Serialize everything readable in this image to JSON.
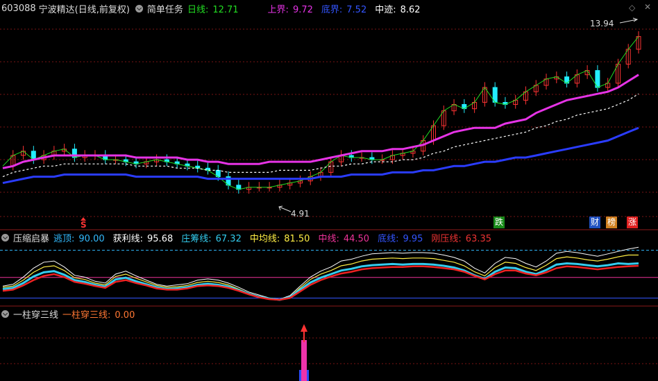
{
  "header": {
    "code": "603088",
    "name": "宁波精达(日线,前复权)",
    "indicator": "简单任务",
    "items": [
      {
        "label": "日线:",
        "value": "12.71",
        "color": "#22dd22"
      },
      {
        "label": "上界:",
        "value": "9.72",
        "color": "#e633e6"
      },
      {
        "label": "底界:",
        "value": "7.52",
        "color": "#3355ff"
      },
      {
        "label": "中迹:",
        "value": "8.62",
        "color": "#ffffff"
      }
    ]
  },
  "corner_icons": [
    "diamond-icon",
    "close-icon"
  ],
  "price_panel": {
    "high_label": "13.94",
    "low_label": "4.91",
    "signal_s": "S",
    "badges": [
      {
        "text": "涨",
        "bg": "#e02020"
      },
      {
        "text": "榜",
        "bg": "#d08020"
      },
      {
        "text": "财",
        "bg": "#2050c0"
      },
      {
        "text": "跌",
        "bg": "#1a8a1a"
      }
    ]
  },
  "indicator_panel": {
    "title": "压缩启暴",
    "items": [
      {
        "label": "逃顶:",
        "value": "90.00",
        "color": "#33bbff"
      },
      {
        "label": "获利线:",
        "value": "95.68",
        "color": "#ffffff"
      },
      {
        "label": "庄筹线:",
        "value": "67.32",
        "color": "#33ccee"
      },
      {
        "label": "中均线:",
        "value": "81.50",
        "color": "#ffee44"
      },
      {
        "label": "中线:",
        "value": "44.50",
        "color": "#ee3399"
      },
      {
        "label": "底线:",
        "value": "9.95",
        "color": "#3355ff"
      },
      {
        "label": "刚压线:",
        "value": "63.35",
        "color": "#ee3333"
      }
    ]
  },
  "column_panel": {
    "title": "一柱穿三线",
    "items": [
      {
        "label": "一柱穿三线:",
        "value": "0.00",
        "color": "#ff7733"
      }
    ]
  },
  "chart_data": {
    "type": "line",
    "series": [
      {
        "name": "日线",
        "values": [
          7.4,
          7.9,
          8.1,
          7.7,
          7.9,
          8.1,
          8.2,
          7.8,
          7.9,
          7.9,
          7.7,
          7.7,
          7.6,
          7.5,
          7.6,
          7.7,
          7.6,
          7.5,
          7.4,
          7.3,
          7.2,
          6.9,
          6.5,
          6.3,
          6.4,
          6.4,
          6.4,
          6.5,
          6.6,
          6.7,
          6.9,
          7.1,
          7.6,
          7.9,
          7.8,
          7.8,
          7.7,
          7.7,
          7.9,
          8.0,
          8.1,
          8.6,
          9.3,
          10.0,
          10.3,
          10.1,
          10.4,
          11.1,
          10.4,
          10.3,
          10.5,
          10.9,
          11.2,
          11.5,
          11.6,
          11.3,
          11.7,
          11.9,
          11.1,
          11.3,
          12.2,
          12.9,
          13.5
        ]
      },
      {
        "name": "上界",
        "values": [
          7.3,
          7.4,
          7.6,
          7.7,
          7.8,
          7.9,
          7.9,
          7.9,
          7.9,
          7.9,
          7.9,
          7.9,
          7.9,
          7.8,
          7.8,
          7.8,
          7.8,
          7.8,
          7.7,
          7.7,
          7.6,
          7.6,
          7.5,
          7.5,
          7.5,
          7.5,
          7.6,
          7.6,
          7.6,
          7.6,
          7.6,
          7.7,
          7.8,
          7.9,
          8.0,
          8.1,
          8.1,
          8.1,
          8.2,
          8.2,
          8.3,
          8.4,
          8.6,
          8.8,
          9.0,
          9.1,
          9.2,
          9.2,
          9.2,
          9.4,
          9.5,
          9.6,
          9.9,
          10.1,
          10.3,
          10.5,
          10.6,
          10.7,
          10.8,
          10.9,
          11.1,
          11.4,
          11.7
        ]
      },
      {
        "name": "中迹",
        "values": [
          6.9,
          7.1,
          7.2,
          7.3,
          7.4,
          7.4,
          7.5,
          7.5,
          7.5,
          7.5,
          7.5,
          7.5,
          7.5,
          7.4,
          7.4,
          7.4,
          7.4,
          7.3,
          7.3,
          7.3,
          7.2,
          7.2,
          7.1,
          7.1,
          7.1,
          7.1,
          7.1,
          7.2,
          7.2,
          7.2,
          7.2,
          7.3,
          7.4,
          7.4,
          7.5,
          7.5,
          7.6,
          7.6,
          7.6,
          7.7,
          7.7,
          7.8,
          8.0,
          8.1,
          8.3,
          8.4,
          8.5,
          8.6,
          8.7,
          8.8,
          8.9,
          9.0,
          9.2,
          9.3,
          9.5,
          9.6,
          9.8,
          9.9,
          10.0,
          10.1,
          10.3,
          10.5,
          10.8
        ]
      },
      {
        "name": "底界",
        "values": [
          6.6,
          6.7,
          6.8,
          6.9,
          6.9,
          6.9,
          7.0,
          7.0,
          7.0,
          7.0,
          7.0,
          7.0,
          7.0,
          6.9,
          6.9,
          6.9,
          6.9,
          6.9,
          6.9,
          6.9,
          6.8,
          6.8,
          6.8,
          6.8,
          6.8,
          6.8,
          6.8,
          6.8,
          6.8,
          6.8,
          6.8,
          6.9,
          6.9,
          6.9,
          7.0,
          7.0,
          7.0,
          7.0,
          7.1,
          7.1,
          7.1,
          7.2,
          7.2,
          7.3,
          7.4,
          7.4,
          7.5,
          7.6,
          7.6,
          7.7,
          7.8,
          7.8,
          7.9,
          8.0,
          8.1,
          8.2,
          8.3,
          8.4,
          8.5,
          8.6,
          8.8,
          9.0,
          9.2
        ]
      }
    ],
    "ylim": [
      4.5,
      14.5
    ],
    "indicator_series": [
      {
        "name": "获利线",
        "values": [
          30,
          33,
          45,
          60,
          70,
          72,
          62,
          48,
          45,
          38,
          35,
          50,
          55,
          47,
          40,
          33,
          30,
          32,
          34,
          40,
          42,
          40,
          35,
          28,
          20,
          15,
          10,
          8,
          14,
          30,
          45,
          55,
          62,
          72,
          75,
          80,
          84,
          85,
          86,
          85,
          86,
          86,
          85,
          82,
          78,
          72,
          60,
          52,
          68,
          78,
          76,
          68,
          62,
          72,
          85,
          88,
          86,
          83,
          80,
          84,
          88,
          92,
          95
        ]
      },
      {
        "name": "中均线",
        "values": [
          28,
          30,
          40,
          53,
          62,
          64,
          56,
          44,
          41,
          35,
          32,
          46,
          50,
          43,
          37,
          31,
          28,
          29,
          31,
          36,
          38,
          36,
          32,
          25,
          18,
          13,
          9,
          7,
          12,
          27,
          41,
          50,
          56,
          64,
          67,
          72,
          75,
          76,
          77,
          76,
          77,
          77,
          76,
          73,
          70,
          64,
          54,
          47,
          61,
          70,
          68,
          61,
          56,
          65,
          76,
          79,
          77,
          74,
          72,
          75,
          79,
          82,
          82
        ]
      },
      {
        "name": "庄筹线",
        "values": [
          25,
          27,
          35,
          46,
          53,
          55,
          49,
          40,
          37,
          32,
          29,
          41,
          44,
          38,
          33,
          28,
          25,
          26,
          28,
          32,
          34,
          32,
          29,
          23,
          17,
          12,
          9,
          7,
          11,
          24,
          36,
          44,
          50,
          56,
          59,
          63,
          65,
          66,
          67,
          66,
          67,
          67,
          66,
          64,
          61,
          56,
          48,
          42,
          54,
          61,
          60,
          54,
          50,
          57,
          66,
          68,
          67,
          65,
          63,
          65,
          68,
          67,
          68
        ]
      },
      {
        "name": "刚压线",
        "values": [
          22,
          24,
          31,
          40,
          47,
          50,
          45,
          37,
          34,
          30,
          27,
          37,
          40,
          35,
          31,
          26,
          24,
          24,
          26,
          30,
          31,
          30,
          27,
          22,
          16,
          11,
          8,
          7,
          10,
          21,
          32,
          40,
          46,
          51,
          54,
          58,
          60,
          61,
          62,
          62,
          63,
          63,
          62,
          60,
          58,
          54,
          47,
          41,
          50,
          56,
          56,
          51,
          48,
          53,
          60,
          63,
          62,
          60,
          58,
          60,
          62,
          63,
          64
        ]
      }
    ],
    "indicator_levels": [
      90.0,
      44.5,
      9.95
    ],
    "indicator_ylim": [
      0,
      100
    ]
  }
}
